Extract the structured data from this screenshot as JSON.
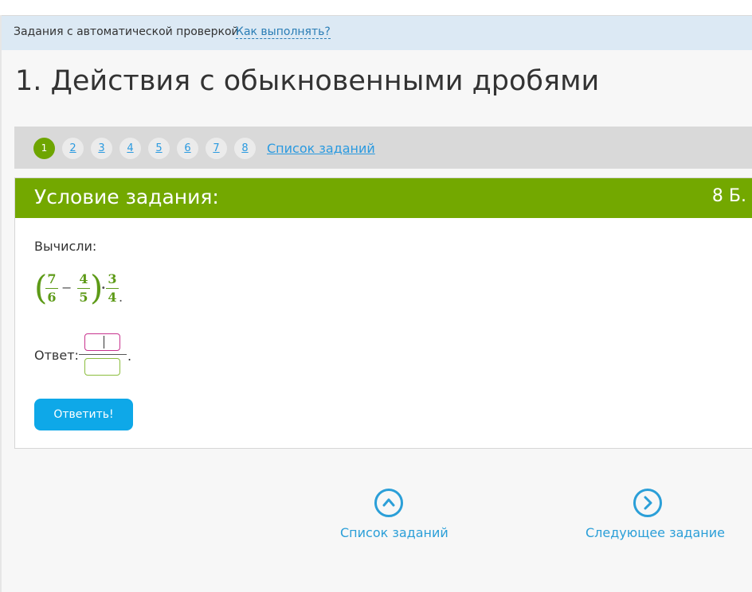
{
  "info_bar": {
    "text": "Задания с автоматической проверкой",
    "how_link": "Как выполнять?"
  },
  "page_title": "1. Действия с обыкновенными дробями",
  "pager": {
    "pages": [
      "1",
      "2",
      "3",
      "4",
      "5",
      "6",
      "7",
      "8"
    ],
    "active_page": "1",
    "list_link": "Список заданий"
  },
  "task": {
    "header": "Условие задания:",
    "points": "8 Б.",
    "prompt": "Вычисли:",
    "expression": {
      "open_paren": "(",
      "close_paren": ")",
      "frac1": {
        "num": "7",
        "den": "6"
      },
      "minus": "−",
      "frac2": {
        "num": "4",
        "den": "5"
      },
      "dot": "·",
      "frac3": {
        "num": "3",
        "den": "4"
      },
      "end": "."
    },
    "answer_label": "Ответ:",
    "answer_end": ".",
    "submit_label": "Ответить!"
  },
  "bottom_nav": {
    "list_label": "Список заданий",
    "list_icon": "chevron-up-circle-icon",
    "next_label": "Следующее задание",
    "next_icon": "chevron-right-circle-icon"
  },
  "colors": {
    "accent_green": "#73a800",
    "link_blue": "#2a9ae0",
    "button_blue": "#0ea8e8",
    "info_bg": "#dce9f4",
    "math_green": "#5d9a17",
    "numerator_border": "#c8338e",
    "denominator_border": "#8bbd3d"
  }
}
